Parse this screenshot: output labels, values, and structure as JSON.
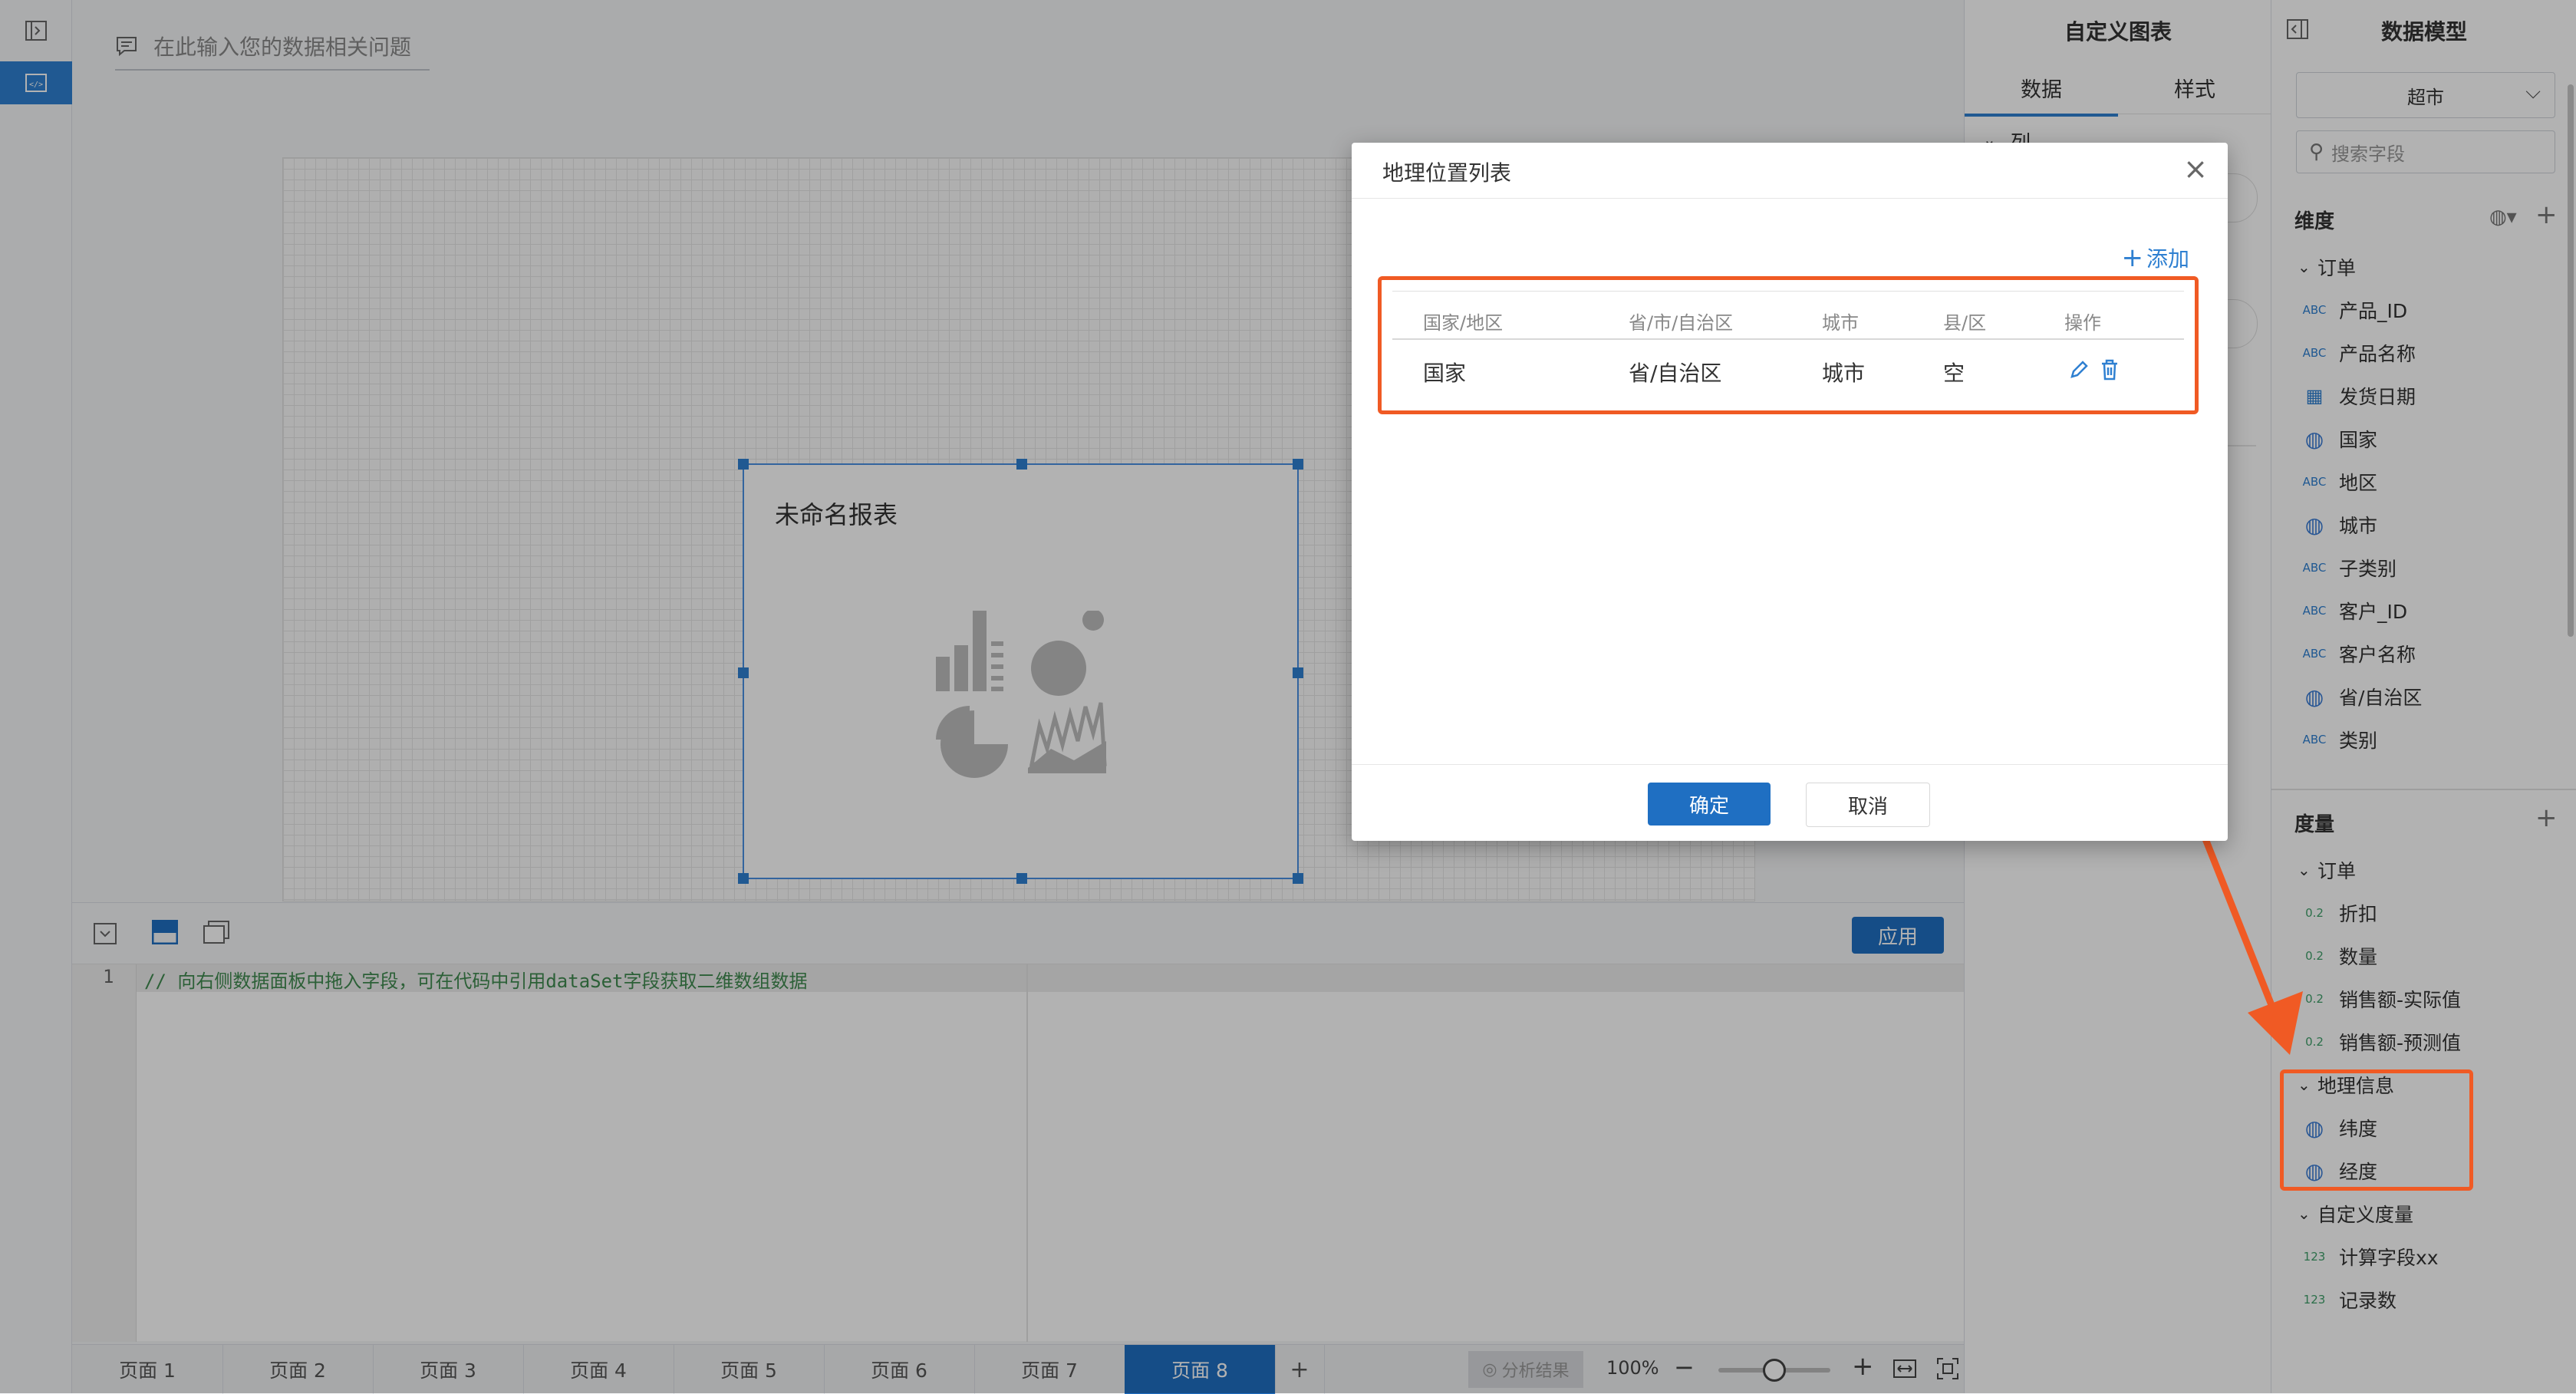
{
  "question_bar": {
    "icon": "chat-icon",
    "placeholder": "在此输入您的数据相关问题"
  },
  "widget": {
    "title": "未命名报表"
  },
  "editor": {
    "apply_label": "应用",
    "line_number": "1",
    "code_comment": "// 向右侧数据面板中拖入字段，可在代码中引用dataSet字段获取二维数组数据"
  },
  "bottom_tabs": {
    "pages": [
      "页面 1",
      "页面 2",
      "页面 3",
      "页面 4",
      "页面 5",
      "页面 6",
      "页面 7",
      "页面 8"
    ],
    "active_index": 7,
    "add_label": "+",
    "analysis_label": "分析结果",
    "zoom_level": "100%",
    "zoom_minus": "−",
    "zoom_plus": "+",
    "zoom_slider_value": 0.5
  },
  "chart_panel": {
    "title": "自定义图表",
    "tabs": [
      "数据",
      "样式"
    ],
    "active_tab": 0,
    "section_label": "列"
  },
  "model_panel": {
    "title": "数据模型",
    "dataset_select": "超市",
    "search_placeholder": "搜索字段",
    "dimensions_label": "维度",
    "dimension_group": "订单",
    "dimension_fields": [
      {
        "icon": "abc-icon",
        "label": "产品_ID"
      },
      {
        "icon": "abc-icon",
        "label": "产品名称"
      },
      {
        "icon": "calendar-icon",
        "label": "发货日期"
      },
      {
        "icon": "globe-icon",
        "label": "国家"
      },
      {
        "icon": "abc-icon",
        "label": "地区"
      },
      {
        "icon": "globe-icon",
        "label": "城市"
      },
      {
        "icon": "abc-icon",
        "label": "子类别"
      },
      {
        "icon": "abc-icon",
        "label": "客户_ID"
      },
      {
        "icon": "abc-icon",
        "label": "客户名称"
      },
      {
        "icon": "globe-icon",
        "label": "省/自治区"
      },
      {
        "icon": "abc-icon",
        "label": "类别"
      }
    ],
    "measures_label": "度量",
    "measure_group": "订单",
    "measure_fields": [
      {
        "icon": "0.2",
        "label": "折扣"
      },
      {
        "icon": "0.2",
        "label": "数量"
      },
      {
        "icon": "0.2",
        "label": "销售额-实际值"
      },
      {
        "icon": "0.2",
        "label": "销售额-预测值"
      }
    ],
    "geo_group": "地理信息",
    "geo_fields": [
      {
        "icon": "globe-icon",
        "label": "纬度"
      },
      {
        "icon": "globe-icon",
        "label": "经度"
      }
    ],
    "custom_group": "自定义度量",
    "custom_fields": [
      {
        "icon": "123",
        "label": "计算字段xx"
      },
      {
        "icon": "123",
        "label": "记录数"
      }
    ],
    "abc_text": "ABC"
  },
  "dialog": {
    "title": "地理位置列表",
    "add_label": "添加",
    "columns": [
      "国家/地区",
      "省/市/自治区",
      "城市",
      "县/区",
      "操作"
    ],
    "rows": [
      [
        "国家",
        "省/自治区",
        "城市",
        "空"
      ]
    ],
    "confirm_label": "确定",
    "cancel_label": "取消"
  },
  "colors": {
    "accent": "#2f80d1",
    "highlight": "#f05a24",
    "active_tab": "#1f6fc2"
  }
}
